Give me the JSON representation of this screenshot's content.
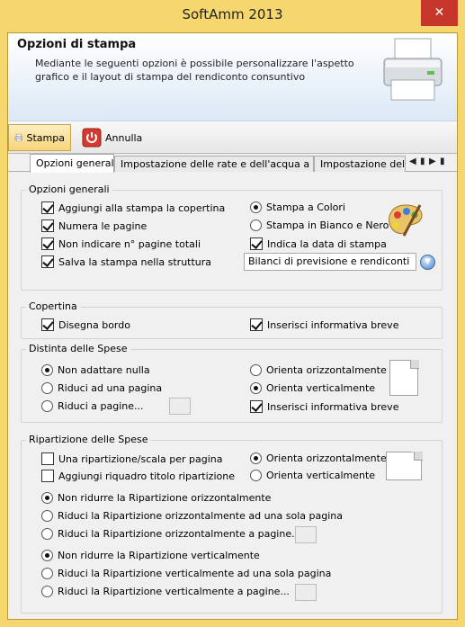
{
  "window": {
    "title": "SoftAmm 2013",
    "close_glyph": "✕"
  },
  "header": {
    "title": "Opzioni di stampa",
    "description": "Mediante le seguenti opzioni è possibile personalizzare l'aspetto grafico e il layout di stampa del rendiconto consuntivo",
    "icon": "printer-icon"
  },
  "toolbar": {
    "print_label": "Stampa",
    "cancel_label": "Annulla"
  },
  "tabs": [
    "Opzioni generali",
    "Impostazione delle rate e dell'acqua a fasce",
    "Impostazione delle p"
  ],
  "tab_nav": {
    "prev": "◀",
    "next": "▶",
    "first_last": "▮"
  },
  "general": {
    "label": "Opzioni generali",
    "cover": {
      "label": "Aggiungi alla stampa la copertina",
      "checked": true
    },
    "numbers": {
      "label": "Numera le pagine",
      "checked": true
    },
    "no_total": {
      "label": "Non indicare n° pagine totali",
      "checked": true
    },
    "save": {
      "label": "Salva la stampa nella struttura",
      "checked": true
    },
    "color": {
      "label": "Stampa a Colori",
      "checked": true
    },
    "bw": {
      "label": "Stampa in Bianco e Nero",
      "checked": false
    },
    "date": {
      "label": "Indica la data di stampa",
      "checked": true
    },
    "structure_value": "Bilanci di previsione e rendiconti"
  },
  "copertina": {
    "label": "Copertina",
    "border": {
      "label": "Disegna bordo",
      "checked": true
    },
    "info": {
      "label": "Inserisci informativa breve",
      "checked": true
    }
  },
  "distinta": {
    "label": "Distinta delle Spese",
    "no_fit": {
      "label": "Non adattare nulla",
      "checked": true
    },
    "one_page": {
      "label": "Riduci ad una pagina",
      "checked": false
    },
    "pages": {
      "label": "Riduci a pagine...",
      "checked": false
    },
    "horizontal": {
      "label": "Orienta orizzontalmente",
      "checked": false
    },
    "vertical": {
      "label": "Orienta verticalmente",
      "checked": true
    },
    "info": {
      "label": "Inserisci informativa breve",
      "checked": true
    }
  },
  "ripartizione": {
    "label": "Ripartizione delle Spese",
    "one_per_page": {
      "label": "Una ripartizione/scala per pagina",
      "checked": false
    },
    "title_box": {
      "label": "Aggiungi riquadro titolo ripartizione",
      "checked": false
    },
    "horizontal": {
      "label": "Orienta orizzontalmente",
      "checked": true
    },
    "vertical": {
      "label": "Orienta verticalmente",
      "checked": false
    },
    "h_no_reduce": {
      "label": "Non ridurre la Ripartizione orizzontalmente",
      "checked": true
    },
    "h_one_page": {
      "label": "Riduci la Ripartizione orizzontalmente ad una sola pagina",
      "checked": false
    },
    "h_pages": {
      "label": "Riduci la Ripartizione orizzontalmente a pagine...",
      "checked": false
    },
    "v_no_reduce": {
      "label": "Non ridurre la Ripartizione verticalmente",
      "checked": true
    },
    "v_one_page": {
      "label": "Riduci la Ripartizione verticalmente ad una sola pagina",
      "checked": false
    },
    "v_pages": {
      "label": "Riduci la Ripartizione verticalmente a pagine...",
      "checked": false
    }
  },
  "colors": {
    "title_bar": "#f5d76e",
    "close_button": "#c7362b",
    "active_toolbar": "#f8d47a"
  }
}
